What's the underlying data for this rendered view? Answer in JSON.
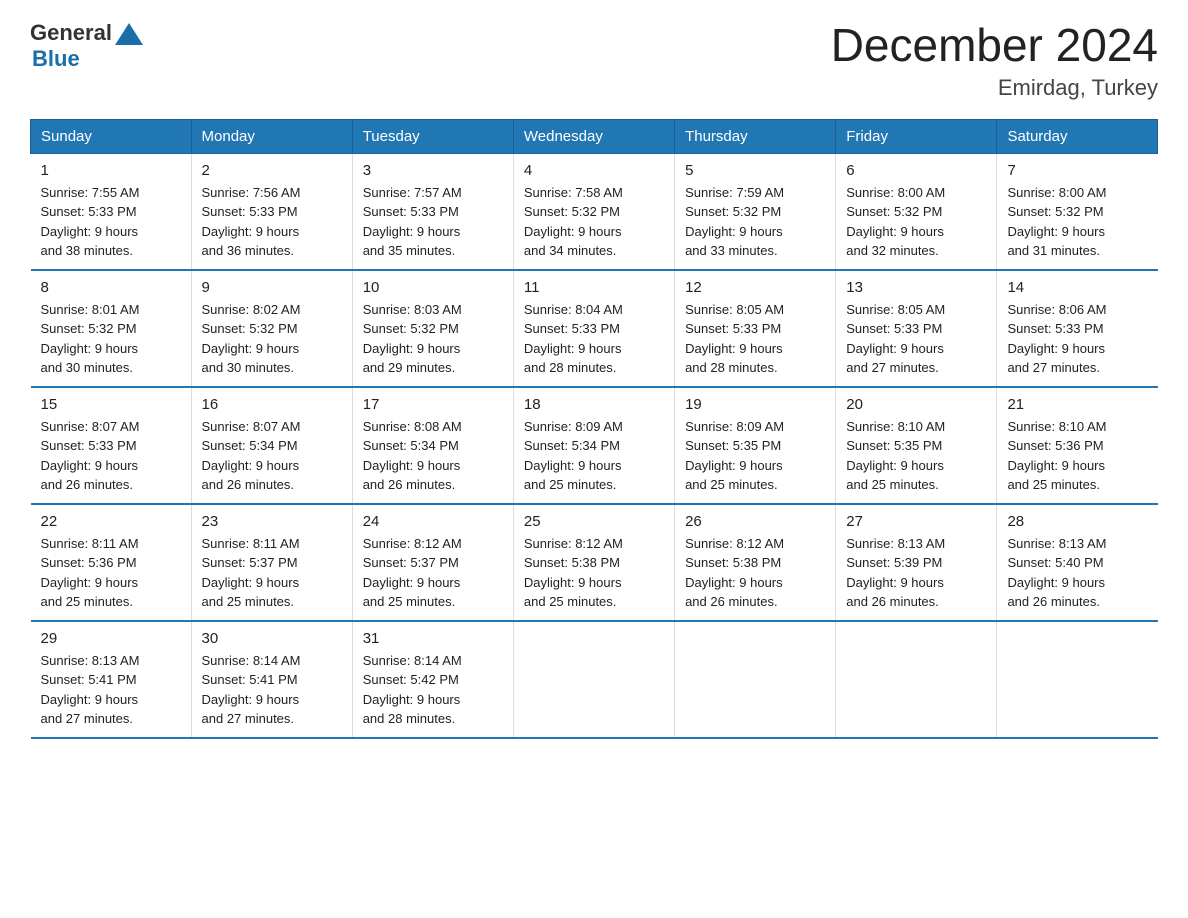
{
  "logo": {
    "general": "General",
    "blue": "Blue"
  },
  "title": "December 2024",
  "subtitle": "Emirdag, Turkey",
  "days": [
    "Sunday",
    "Monday",
    "Tuesday",
    "Wednesday",
    "Thursday",
    "Friday",
    "Saturday"
  ],
  "weeks": [
    [
      {
        "day": "1",
        "sunrise": "7:55 AM",
        "sunset": "5:33 PM",
        "daylight": "9 hours and 38 minutes."
      },
      {
        "day": "2",
        "sunrise": "7:56 AM",
        "sunset": "5:33 PM",
        "daylight": "9 hours and 36 minutes."
      },
      {
        "day": "3",
        "sunrise": "7:57 AM",
        "sunset": "5:33 PM",
        "daylight": "9 hours and 35 minutes."
      },
      {
        "day": "4",
        "sunrise": "7:58 AM",
        "sunset": "5:32 PM",
        "daylight": "9 hours and 34 minutes."
      },
      {
        "day": "5",
        "sunrise": "7:59 AM",
        "sunset": "5:32 PM",
        "daylight": "9 hours and 33 minutes."
      },
      {
        "day": "6",
        "sunrise": "8:00 AM",
        "sunset": "5:32 PM",
        "daylight": "9 hours and 32 minutes."
      },
      {
        "day": "7",
        "sunrise": "8:00 AM",
        "sunset": "5:32 PM",
        "daylight": "9 hours and 31 minutes."
      }
    ],
    [
      {
        "day": "8",
        "sunrise": "8:01 AM",
        "sunset": "5:32 PM",
        "daylight": "9 hours and 30 minutes."
      },
      {
        "day": "9",
        "sunrise": "8:02 AM",
        "sunset": "5:32 PM",
        "daylight": "9 hours and 30 minutes."
      },
      {
        "day": "10",
        "sunrise": "8:03 AM",
        "sunset": "5:32 PM",
        "daylight": "9 hours and 29 minutes."
      },
      {
        "day": "11",
        "sunrise": "8:04 AM",
        "sunset": "5:33 PM",
        "daylight": "9 hours and 28 minutes."
      },
      {
        "day": "12",
        "sunrise": "8:05 AM",
        "sunset": "5:33 PM",
        "daylight": "9 hours and 28 minutes."
      },
      {
        "day": "13",
        "sunrise": "8:05 AM",
        "sunset": "5:33 PM",
        "daylight": "9 hours and 27 minutes."
      },
      {
        "day": "14",
        "sunrise": "8:06 AM",
        "sunset": "5:33 PM",
        "daylight": "9 hours and 27 minutes."
      }
    ],
    [
      {
        "day": "15",
        "sunrise": "8:07 AM",
        "sunset": "5:33 PM",
        "daylight": "9 hours and 26 minutes."
      },
      {
        "day": "16",
        "sunrise": "8:07 AM",
        "sunset": "5:34 PM",
        "daylight": "9 hours and 26 minutes."
      },
      {
        "day": "17",
        "sunrise": "8:08 AM",
        "sunset": "5:34 PM",
        "daylight": "9 hours and 26 minutes."
      },
      {
        "day": "18",
        "sunrise": "8:09 AM",
        "sunset": "5:34 PM",
        "daylight": "9 hours and 25 minutes."
      },
      {
        "day": "19",
        "sunrise": "8:09 AM",
        "sunset": "5:35 PM",
        "daylight": "9 hours and 25 minutes."
      },
      {
        "day": "20",
        "sunrise": "8:10 AM",
        "sunset": "5:35 PM",
        "daylight": "9 hours and 25 minutes."
      },
      {
        "day": "21",
        "sunrise": "8:10 AM",
        "sunset": "5:36 PM",
        "daylight": "9 hours and 25 minutes."
      }
    ],
    [
      {
        "day": "22",
        "sunrise": "8:11 AM",
        "sunset": "5:36 PM",
        "daylight": "9 hours and 25 minutes."
      },
      {
        "day": "23",
        "sunrise": "8:11 AM",
        "sunset": "5:37 PM",
        "daylight": "9 hours and 25 minutes."
      },
      {
        "day": "24",
        "sunrise": "8:12 AM",
        "sunset": "5:37 PM",
        "daylight": "9 hours and 25 minutes."
      },
      {
        "day": "25",
        "sunrise": "8:12 AM",
        "sunset": "5:38 PM",
        "daylight": "9 hours and 25 minutes."
      },
      {
        "day": "26",
        "sunrise": "8:12 AM",
        "sunset": "5:38 PM",
        "daylight": "9 hours and 26 minutes."
      },
      {
        "day": "27",
        "sunrise": "8:13 AM",
        "sunset": "5:39 PM",
        "daylight": "9 hours and 26 minutes."
      },
      {
        "day": "28",
        "sunrise": "8:13 AM",
        "sunset": "5:40 PM",
        "daylight": "9 hours and 26 minutes."
      }
    ],
    [
      {
        "day": "29",
        "sunrise": "8:13 AM",
        "sunset": "5:41 PM",
        "daylight": "9 hours and 27 minutes."
      },
      {
        "day": "30",
        "sunrise": "8:14 AM",
        "sunset": "5:41 PM",
        "daylight": "9 hours and 27 minutes."
      },
      {
        "day": "31",
        "sunrise": "8:14 AM",
        "sunset": "5:42 PM",
        "daylight": "9 hours and 28 minutes."
      },
      null,
      null,
      null,
      null
    ]
  ],
  "labels": {
    "sunrise": "Sunrise:",
    "sunset": "Sunset:",
    "daylight": "Daylight:"
  }
}
